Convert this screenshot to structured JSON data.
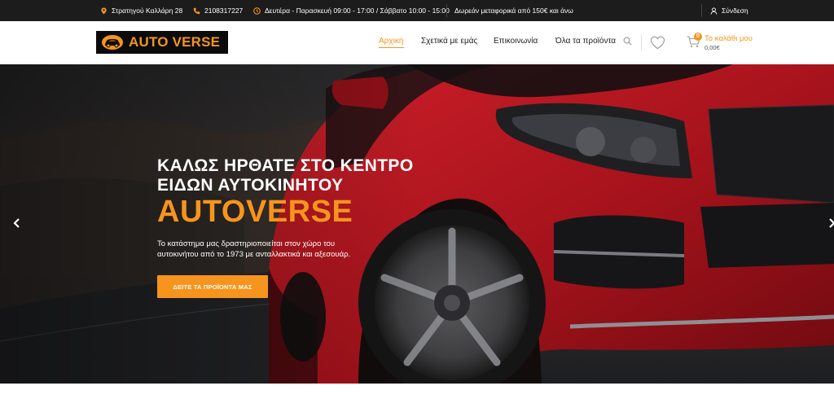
{
  "topbar": {
    "address": "Στρατηγού Καλλάρη 28",
    "phone": "2108317227",
    "hours": "Δευτέρα - Παρασκευή 09:00 - 17:00 / Σάββατο 10:00 - 15:00",
    "shipping": "Δωρεάν μεταφορικά από 150€ και άνω",
    "login": "Σύνδεση",
    "icons": [
      "location-pin-icon",
      "phone-icon",
      "clock-icon",
      "user-icon"
    ]
  },
  "header": {
    "logo_text": "AUTO VERSE",
    "nav": [
      {
        "label": "Αρχική",
        "active": true
      },
      {
        "label": "Σχετικά με εμάς",
        "active": false
      },
      {
        "label": "Επικοινωνία",
        "active": false
      },
      {
        "label": "Όλα τα προϊόντα",
        "active": false
      }
    ],
    "cart": {
      "count": "0",
      "label": "Το καλάθι μου",
      "amount": "0,00€"
    }
  },
  "hero": {
    "title_line1": "ΚΑΛΩΣ ΗΡΘΑΤΕ ΣΤΟ ΚΕΝΤΡΟ",
    "title_line2": "ΕΙΔΩΝ ΑΥΤΟΚΙΝΗΤΟΥ",
    "brand": "AUTOVERSE",
    "desc_line1": "Το κατάστημα μας δραστηριοποιείται στον χώρο του",
    "desc_line2": "αυτοκινήτου από το 1973 με ανταλλακτικά και αξεσουάρ.",
    "cta": "ΔΕΙΤΕ ΤΑ ΠΡΟΪΟΝΤΑ ΜΑΣ"
  },
  "colors": {
    "accent": "#f7941d",
    "topbar_bg": "#1c1c1c",
    "car_red": "#b3141c"
  }
}
